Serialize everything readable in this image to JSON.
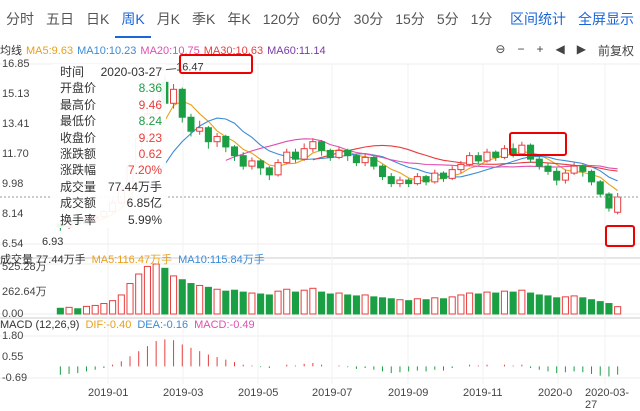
{
  "tabs": [
    "分时",
    "五日",
    "日K",
    "周K",
    "月K",
    "季K",
    "年K",
    "120分",
    "60分",
    "30分",
    "15分",
    "5分",
    "1分"
  ],
  "active_tab": "周K",
  "right_tabs": [
    "区间统计",
    "全屏显示"
  ],
  "ma": {
    "label": "均线",
    "items": [
      {
        "text": "MA5:9.63",
        "color": "#e8a01b"
      },
      {
        "text": "MA10:10.23",
        "color": "#3b8bd6"
      },
      {
        "text": "MA20:10.75",
        "color": "#e04fb0"
      },
      {
        "text": "MA30:10.63",
        "color": "#e83d3d"
      },
      {
        "text": "MA60:11.14",
        "color": "#7a3aa8"
      }
    ]
  },
  "toolbar": {
    "restore": "前复权"
  },
  "price_axis": [
    "16.85",
    "15.13",
    "13.41",
    "11.70",
    "9.98",
    "8.14",
    "6.54"
  ],
  "high_label": "16.47",
  "low_label": "6.93",
  "tooltip": [
    {
      "k": "时间",
      "v": "2020-03-27",
      "c": ""
    },
    {
      "k": "开盘价",
      "v": "8.36",
      "c": "green"
    },
    {
      "k": "最高价",
      "v": "9.46",
      "c": "red"
    },
    {
      "k": "最低价",
      "v": "8.24",
      "c": "green"
    },
    {
      "k": "收盘价",
      "v": "9.23",
      "c": "red"
    },
    {
      "k": "涨跌额",
      "v": "0.62",
      "c": "red"
    },
    {
      "k": "涨跌幅",
      "v": "7.20%",
      "c": "red"
    },
    {
      "k": "成交量",
      "v": "77.44万手",
      "c": ""
    },
    {
      "k": "成交额",
      "v": "6.85亿",
      "c": ""
    },
    {
      "k": "换手率",
      "v": "5.99%",
      "c": ""
    }
  ],
  "volume": {
    "items": [
      {
        "text": "成交量 77.44万手",
        "color": "#333"
      },
      {
        "text": "MA5:116.47万手",
        "color": "#e8a01b"
      },
      {
        "text": "MA10:115.84万手",
        "color": "#3b8bd6"
      }
    ],
    "axis": [
      "525.28万",
      "262.64万",
      "0.00"
    ]
  },
  "macd": {
    "items": [
      {
        "text": "MACD (12,26,9)",
        "color": "#333"
      },
      {
        "text": "DIF:-0.40",
        "color": "#e8a01b"
      },
      {
        "text": "DEA:-0.16",
        "color": "#3b8bd6"
      },
      {
        "text": "MACD:-0.49",
        "color": "#e04fb0"
      }
    ],
    "axis": [
      "1.80",
      "0.55",
      "-0.69"
    ]
  },
  "dates": [
    "2019-01",
    "2019-03",
    "2019-05",
    "2019-07",
    "2019-09",
    "2019-11",
    "2020-0",
    "2020-03-27"
  ],
  "chart_data": {
    "type": "candlestick",
    "title": "",
    "candles": [
      {
        "o": 7.7,
        "c": 7.5,
        "h": 7.9,
        "l": 7.3
      },
      {
        "o": 7.5,
        "c": 7.8,
        "h": 8.0,
        "l": 7.4
      },
      {
        "o": 7.8,
        "c": 7.7,
        "h": 7.9,
        "l": 7.5
      },
      {
        "o": 7.7,
        "c": 8.0,
        "h": 8.1,
        "l": 7.6
      },
      {
        "o": 8.0,
        "c": 8.1,
        "h": 8.3,
        "l": 7.9
      },
      {
        "o": 8.1,
        "c": 8.4,
        "h": 8.5,
        "l": 8.0
      },
      {
        "o": 8.4,
        "c": 8.9,
        "h": 9.1,
        "l": 8.3
      },
      {
        "o": 8.9,
        "c": 9.6,
        "h": 9.8,
        "l": 8.8
      },
      {
        "o": 9.6,
        "c": 11.0,
        "h": 11.3,
        "l": 9.5
      },
      {
        "o": 11.0,
        "c": 12.6,
        "h": 12.9,
        "l": 10.8
      },
      {
        "o": 12.6,
        "c": 14.0,
        "h": 14.2,
        "l": 12.3
      },
      {
        "o": 14.0,
        "c": 15.8,
        "h": 16.47,
        "l": 13.8
      },
      {
        "o": 15.8,
        "c": 14.6,
        "h": 16.2,
        "l": 14.3
      },
      {
        "o": 14.6,
        "c": 15.4,
        "h": 15.7,
        "l": 14.3
      },
      {
        "o": 15.4,
        "c": 13.8,
        "h": 15.5,
        "l": 13.5
      },
      {
        "o": 13.8,
        "c": 13.0,
        "h": 14.0,
        "l": 12.7
      },
      {
        "o": 13.0,
        "c": 13.2,
        "h": 13.6,
        "l": 12.8
      },
      {
        "o": 13.2,
        "c": 12.4,
        "h": 13.3,
        "l": 12.0
      },
      {
        "o": 12.4,
        "c": 12.7,
        "h": 12.9,
        "l": 12.1
      },
      {
        "o": 12.7,
        "c": 12.1,
        "h": 12.8,
        "l": 11.8
      },
      {
        "o": 12.1,
        "c": 11.6,
        "h": 12.2,
        "l": 11.3
      },
      {
        "o": 11.6,
        "c": 11.0,
        "h": 11.8,
        "l": 10.8
      },
      {
        "o": 11.0,
        "c": 11.3,
        "h": 11.5,
        "l": 10.8
      },
      {
        "o": 11.3,
        "c": 10.9,
        "h": 11.4,
        "l": 10.5
      },
      {
        "o": 10.9,
        "c": 10.5,
        "h": 11.0,
        "l": 10.2
      },
      {
        "o": 10.5,
        "c": 11.2,
        "h": 11.4,
        "l": 10.4
      },
      {
        "o": 11.2,
        "c": 11.8,
        "h": 12.0,
        "l": 11.1
      },
      {
        "o": 11.8,
        "c": 11.4,
        "h": 12.0,
        "l": 11.2
      },
      {
        "o": 11.4,
        "c": 12.0,
        "h": 12.3,
        "l": 11.3
      },
      {
        "o": 12.0,
        "c": 12.4,
        "h": 12.6,
        "l": 11.8
      },
      {
        "o": 12.4,
        "c": 11.9,
        "h": 12.5,
        "l": 11.6
      },
      {
        "o": 11.9,
        "c": 11.5,
        "h": 12.0,
        "l": 11.3
      },
      {
        "o": 11.5,
        "c": 11.9,
        "h": 12.1,
        "l": 11.4
      },
      {
        "o": 11.9,
        "c": 11.6,
        "h": 12.0,
        "l": 11.3
      },
      {
        "o": 11.6,
        "c": 11.2,
        "h": 11.7,
        "l": 11.0
      },
      {
        "o": 11.2,
        "c": 11.5,
        "h": 11.7,
        "l": 11.0
      },
      {
        "o": 11.5,
        "c": 11.0,
        "h": 11.6,
        "l": 10.8
      },
      {
        "o": 11.0,
        "c": 10.4,
        "h": 11.1,
        "l": 10.2
      },
      {
        "o": 10.4,
        "c": 10.0,
        "h": 10.6,
        "l": 9.8
      },
      {
        "o": 10.0,
        "c": 10.2,
        "h": 10.4,
        "l": 9.8
      },
      {
        "o": 10.2,
        "c": 10.0,
        "h": 10.3,
        "l": 9.8
      },
      {
        "o": 10.0,
        "c": 10.4,
        "h": 10.6,
        "l": 9.9
      },
      {
        "o": 10.4,
        "c": 10.1,
        "h": 10.5,
        "l": 9.9
      },
      {
        "o": 10.1,
        "c": 10.6,
        "h": 10.8,
        "l": 10.0
      },
      {
        "o": 10.6,
        "c": 10.3,
        "h": 10.7,
        "l": 10.1
      },
      {
        "o": 10.3,
        "c": 10.8,
        "h": 11.0,
        "l": 10.2
      },
      {
        "o": 10.8,
        "c": 11.1,
        "h": 11.3,
        "l": 10.6
      },
      {
        "o": 11.1,
        "c": 11.6,
        "h": 11.8,
        "l": 11.0
      },
      {
        "o": 11.6,
        "c": 11.3,
        "h": 11.8,
        "l": 11.1
      },
      {
        "o": 11.3,
        "c": 11.8,
        "h": 12.0,
        "l": 11.2
      },
      {
        "o": 11.8,
        "c": 11.5,
        "h": 11.9,
        "l": 11.3
      },
      {
        "o": 11.5,
        "c": 12.0,
        "h": 12.2,
        "l": 11.4
      },
      {
        "o": 12.0,
        "c": 11.7,
        "h": 12.3,
        "l": 11.5
      },
      {
        "o": 11.7,
        "c": 12.2,
        "h": 12.4,
        "l": 11.6
      },
      {
        "o": 12.2,
        "c": 11.4,
        "h": 12.3,
        "l": 11.2
      },
      {
        "o": 11.4,
        "c": 11.0,
        "h": 11.6,
        "l": 10.8
      },
      {
        "o": 11.0,
        "c": 10.7,
        "h": 11.2,
        "l": 10.5
      },
      {
        "o": 10.7,
        "c": 10.2,
        "h": 10.9,
        "l": 9.9
      },
      {
        "o": 10.2,
        "c": 10.6,
        "h": 10.8,
        "l": 10.0
      },
      {
        "o": 10.6,
        "c": 11.0,
        "h": 11.2,
        "l": 10.5
      },
      {
        "o": 11.0,
        "c": 10.7,
        "h": 11.1,
        "l": 10.4
      },
      {
        "o": 10.7,
        "c": 10.1,
        "h": 10.8,
        "l": 9.9
      },
      {
        "o": 10.1,
        "c": 9.4,
        "h": 10.2,
        "l": 9.2
      },
      {
        "o": 9.4,
        "c": 8.6,
        "h": 9.5,
        "l": 8.4
      },
      {
        "o": 8.36,
        "c": 9.23,
        "h": 9.46,
        "l": 8.24
      }
    ],
    "volume": [
      60,
      70,
      55,
      80,
      90,
      110,
      140,
      200,
      320,
      420,
      500,
      525,
      480,
      400,
      360,
      320,
      300,
      280,
      260,
      240,
      250,
      230,
      220,
      210,
      200,
      240,
      260,
      230,
      250,
      270,
      230,
      210,
      220,
      200,
      190,
      200,
      180,
      170,
      160,
      150,
      140,
      160,
      150,
      170,
      160,
      180,
      200,
      220,
      210,
      230,
      220,
      240,
      230,
      250,
      220,
      200,
      190,
      170,
      180,
      190,
      170,
      150,
      130,
      110,
      77
    ],
    "macd": [
      -0.5,
      -0.45,
      -0.4,
      -0.3,
      -0.2,
      -0.1,
      0.1,
      0.3,
      0.6,
      0.9,
      1.2,
      1.5,
      1.6,
      1.55,
      1.3,
      1.1,
      0.9,
      0.7,
      0.55,
      0.4,
      0.25,
      0.1,
      0.05,
      -0.05,
      -0.1,
      0.0,
      0.1,
      0.05,
      0.15,
      0.2,
      0.1,
      0.0,
      0.05,
      -0.05,
      -0.15,
      -0.1,
      -0.2,
      -0.3,
      -0.4,
      -0.35,
      -0.3,
      -0.25,
      -0.3,
      -0.2,
      -0.25,
      -0.1,
      0.0,
      0.1,
      0.05,
      0.1,
      0.0,
      0.1,
      0.05,
      0.1,
      -0.1,
      -0.2,
      -0.3,
      -0.4,
      -0.35,
      -0.3,
      -0.35,
      -0.45,
      -0.55,
      -0.6,
      -0.49
    ],
    "ylim": [
      6.54,
      16.85
    ],
    "vol_max": 525.28,
    "macd_range": [
      -0.69,
      1.8
    ]
  }
}
